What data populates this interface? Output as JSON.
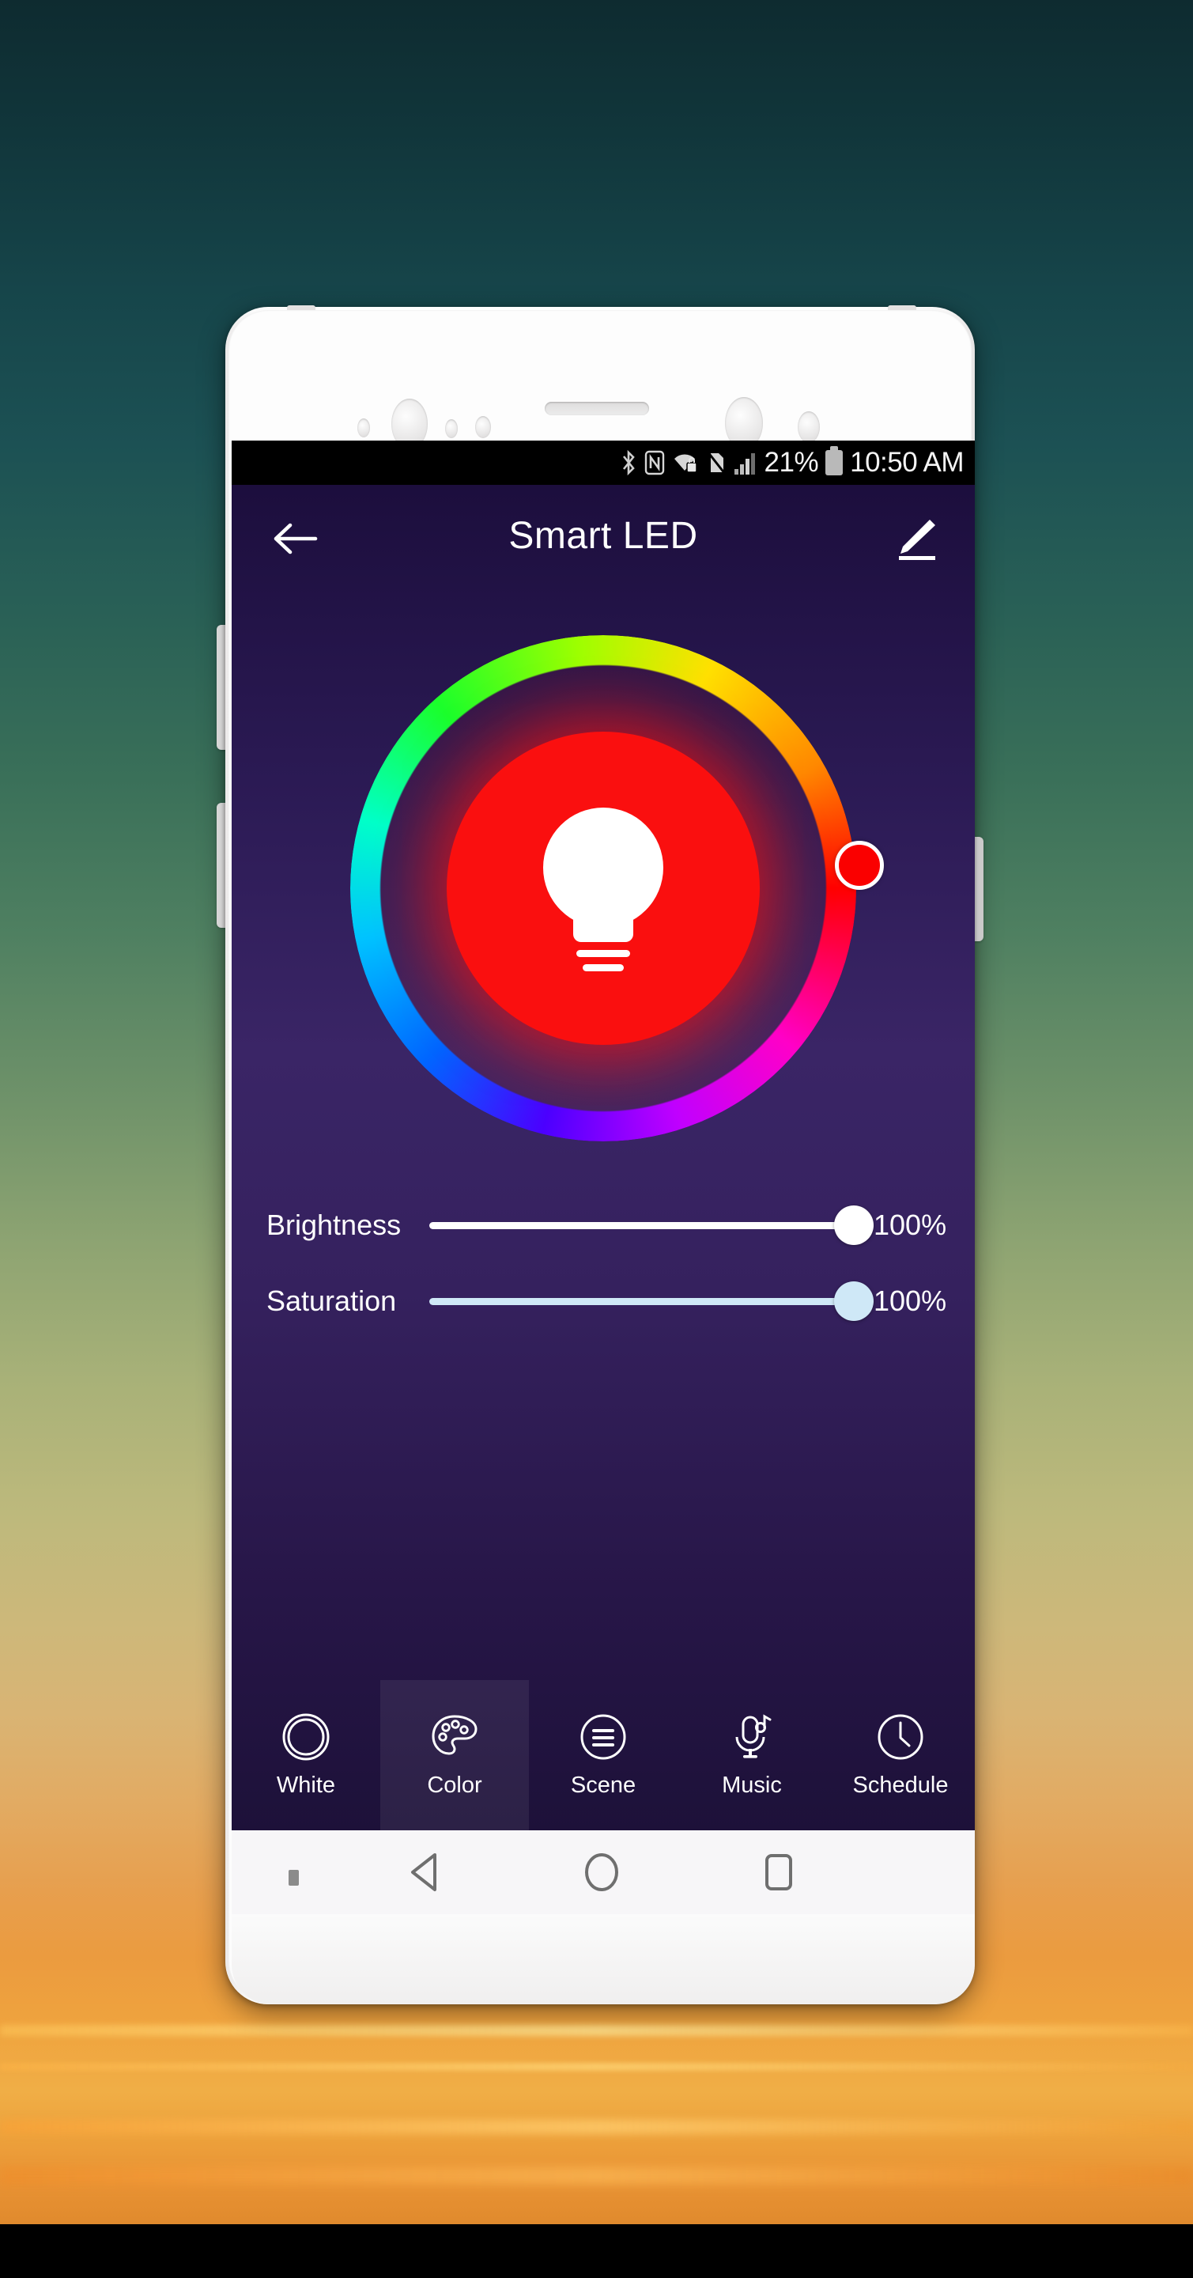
{
  "wallpaper": {
    "description": "sunset-sky-gradient"
  },
  "status_bar": {
    "icons": [
      "bluetooth-icon",
      "nfc-icon",
      "wifi-lock-icon",
      "no-sim-icon",
      "signal-bars-icon"
    ],
    "battery_percent": "21%",
    "battery_icon": "battery-icon",
    "time": "10:50 AM"
  },
  "app_bar": {
    "back_icon": "back-arrow-icon",
    "title": "Smart LED",
    "edit_icon": "pencil-edit-icon"
  },
  "color_picker": {
    "bulb_icon": "light-bulb-icon",
    "selected_color": "#fa0000",
    "thumb_angle_deg": 0,
    "wheel_stops": [
      "#ff0000",
      "#ff00c8",
      "#c000ff",
      "#4b00ff",
      "#0066ff",
      "#00c2ff",
      "#00ffc8",
      "#1aff2b",
      "#9dff00",
      "#ffe000",
      "#ff8800",
      "#ff0000"
    ]
  },
  "sliders": [
    {
      "label": "Brightness",
      "value": "100%",
      "percent": 100,
      "color": "#ffffff"
    },
    {
      "label": "Saturation",
      "value": "100%",
      "percent": 100,
      "color": "#cfe8f7"
    }
  ],
  "tabs": [
    {
      "label": "White",
      "icon": "double-circle-icon",
      "active": false
    },
    {
      "label": "Color",
      "icon": "palette-icon",
      "active": true
    },
    {
      "label": "Scene",
      "icon": "scene-lines-icon",
      "active": false
    },
    {
      "label": "Music",
      "icon": "microphone-note-icon",
      "active": false
    },
    {
      "label": "Schedule",
      "icon": "clock-icon",
      "active": false
    }
  ],
  "nav_bar": {
    "hide_icon": "nav-hide-dot-icon",
    "back_icon": "nav-back-triangle-icon",
    "home_icon": "nav-home-circle-icon",
    "recents_icon": "nav-recents-square-icon"
  },
  "hardware": {
    "volume_up": "volume-up-button",
    "volume_down": "volume-down-button",
    "power": "power-button"
  }
}
